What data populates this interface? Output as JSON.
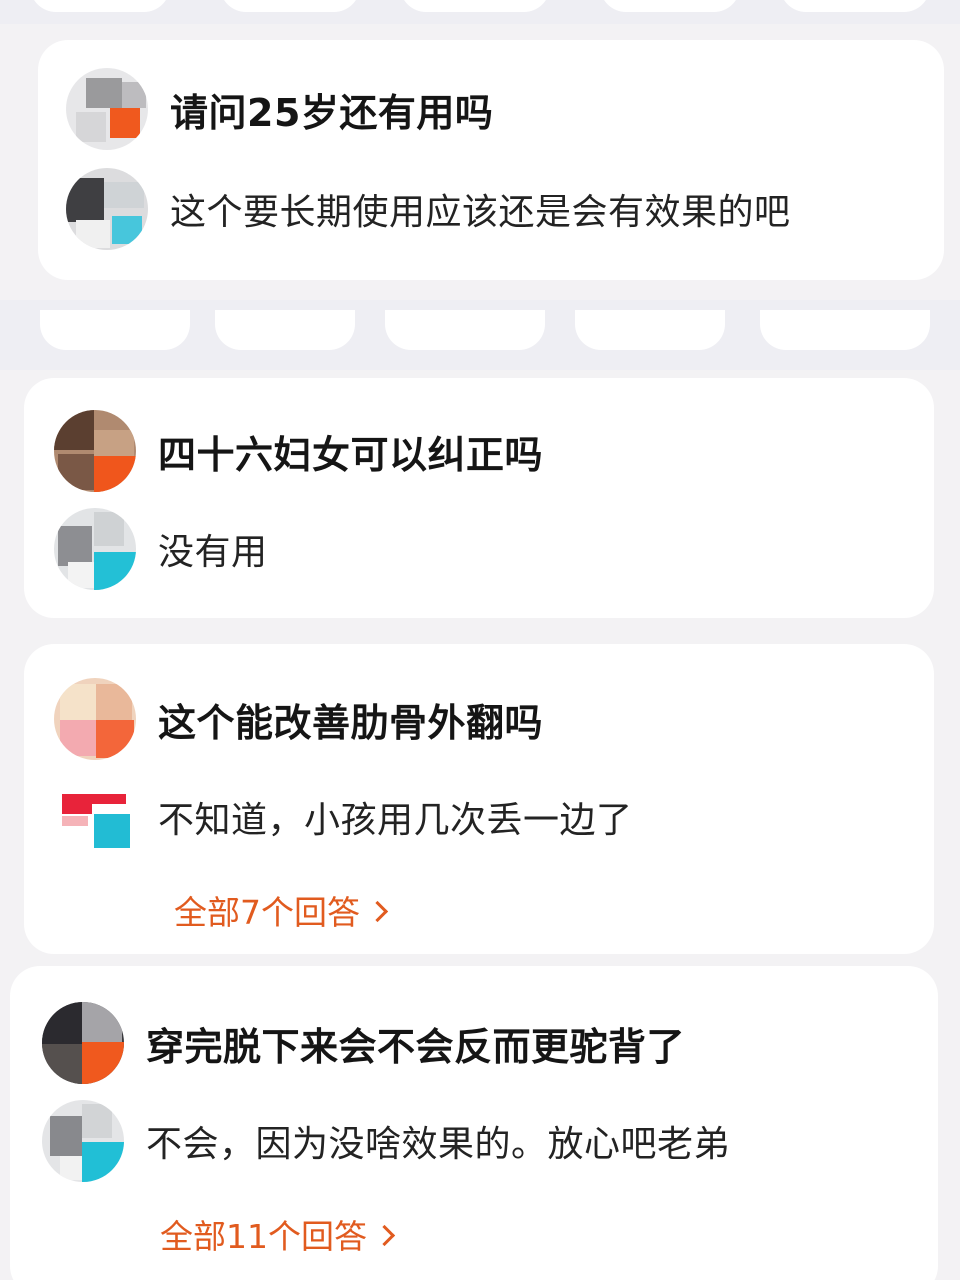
{
  "qa_cards": [
    {
      "question": "请问25岁还有用吗",
      "answer": "这个要长期使用应该还是会有效果的吧"
    },
    {
      "question": "四十六妇女可以纠正吗",
      "answer": "没有用"
    },
    {
      "question": "这个能改善肋骨外翻吗",
      "answer": "不知道，小孩用几次丢一边了",
      "more_label": "全部7个回答"
    },
    {
      "question": "穿完脱下来会不会反而更驼背了",
      "answer": "不会，因为没啥效果的。放心吧老弟",
      "more_label": "全部11个回答"
    }
  ],
  "colors": {
    "accent": "#e15b1f",
    "card_bg": "#ffffff",
    "page_bg": "#f3f2f4"
  },
  "icons": [
    "avatar-blurred",
    "chevron-right-icon"
  ]
}
